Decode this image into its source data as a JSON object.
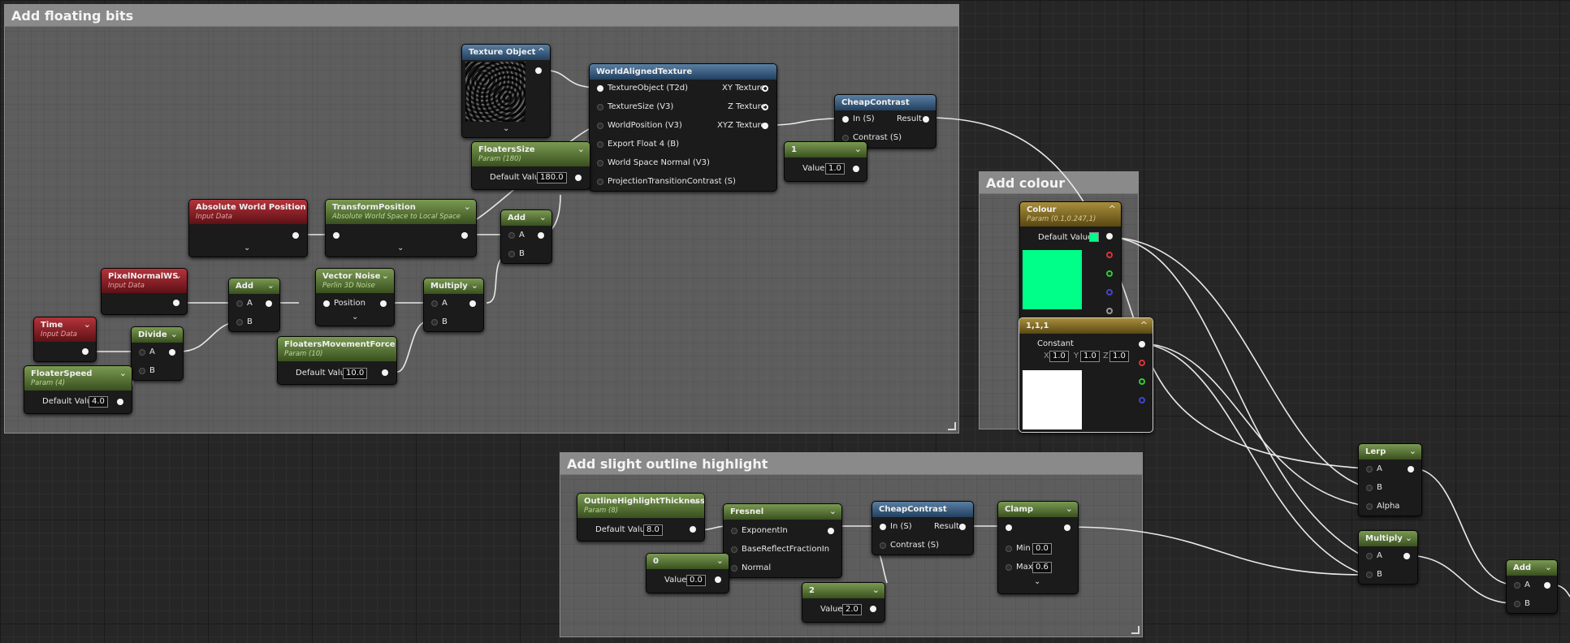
{
  "comments": {
    "floating": {
      "title": "Add floating bits"
    },
    "colour": {
      "title": "Add colour"
    },
    "outline": {
      "title": "Add slight outline highlight"
    }
  },
  "nodes": {
    "texture_object": {
      "title": "Texture Object"
    },
    "world_aligned": {
      "title": "WorldAlignedTexture",
      "inputs": [
        "TextureObject (T2d)",
        "TextureSize (V3)",
        "WorldPosition (V3)",
        "Export Float 4 (B)",
        "World Space Normal (V3)",
        "ProjectionTransitionContrast (S)"
      ],
      "outputs": [
        "XY Texture",
        "Z Texture",
        "XYZ Texture"
      ]
    },
    "cheap_contrast_top": {
      "title": "CheapContrast",
      "in": "In (S)",
      "contrast": "Contrast (S)",
      "result": "Result"
    },
    "const_one": {
      "title": "1",
      "value_label": "Value",
      "value": "1.0"
    },
    "floaters_size": {
      "title": "FloatersSize",
      "sub": "Param (180)",
      "label": "Default Value",
      "value": "180.0"
    },
    "abs_world_pos": {
      "title": "Absolute World Position",
      "sub": "Input Data"
    },
    "transform_pos": {
      "title": "TransformPosition",
      "sub": "Absolute World Space to Local Space"
    },
    "add_top": {
      "title": "Add",
      "a": "A",
      "b": "B"
    },
    "pixel_normal": {
      "title": "PixelNormalWS",
      "sub": "Input Data"
    },
    "add_mid": {
      "title": "Add",
      "a": "A",
      "b": "B"
    },
    "vector_noise": {
      "title": "Vector Noise",
      "sub": "Perlin 3D Noise",
      "pin": "Position"
    },
    "multiply_mid": {
      "title": "Multiply",
      "a": "A",
      "b": "B"
    },
    "time": {
      "title": "Time",
      "sub": "Input Data"
    },
    "divide": {
      "title": "Divide",
      "a": "A",
      "b": "B"
    },
    "floaters_force": {
      "title": "FloatersMovementForce",
      "sub": "Param (10)",
      "label": "Default Value",
      "value": "10.0"
    },
    "floater_speed": {
      "title": "FloaterSpeed",
      "sub": "Param (4)",
      "label": "Default Value",
      "value": "4.0"
    },
    "colour": {
      "title": "Colour",
      "sub": "Param (0.1,0.247,1)",
      "label": "Default Value",
      "swatch": "#00ff88"
    },
    "const_111": {
      "title": "1,1,1",
      "label": "Constant",
      "x_label": "X",
      "x": "1.0",
      "y_label": "Y",
      "y": "1.0",
      "z_label": "Z",
      "z": "1.0",
      "swatch": "#ffffff"
    },
    "outline_thickness": {
      "title": "OutlineHighlightThickness",
      "sub": "Param (8)",
      "label": "Default Value",
      "value": "8.0"
    },
    "fresnel": {
      "title": "Fresnel",
      "inputs": [
        "ExponentIn",
        "BaseReflectFractionIn",
        "Normal"
      ]
    },
    "const_zero": {
      "title": "0",
      "value_label": "Value",
      "value": "0.0"
    },
    "const_two": {
      "title": "2",
      "value_label": "Value",
      "value": "2.0"
    },
    "cheap_contrast_bot": {
      "title": "CheapContrast",
      "in": "In (S)",
      "contrast": "Contrast (S)",
      "result": "Result"
    },
    "clamp": {
      "title": "Clamp",
      "min_label": "Min",
      "min": "0.0",
      "max_label": "Max",
      "max": "0.6"
    },
    "lerp": {
      "title": "Lerp",
      "a": "A",
      "b": "B",
      "alpha": "Alpha"
    },
    "multiply_right": {
      "title": "Multiply",
      "a": "A",
      "b": "B"
    },
    "add_right": {
      "title": "Add",
      "a": "A",
      "b": "B"
    }
  }
}
